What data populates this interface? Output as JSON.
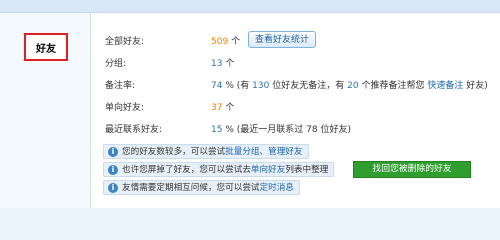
{
  "sidebar": {
    "friend_label": "好友"
  },
  "stats": {
    "all_friends_label": "全部好友:",
    "all_friends_count": "509",
    "all_friends_unit": "个",
    "view_stats_button": "查看好友统计",
    "groups_label": "分组:",
    "groups_count": "13",
    "groups_unit": "个",
    "remark_label": "备注率:",
    "remark_rate": "74",
    "remark_pct": "%",
    "remark_text1": "(有",
    "remark_no_remark_count": "130",
    "remark_text2": "位好友无备注，有",
    "remark_recommend_count": "20",
    "remark_text3": "个推荐备注帮您",
    "quick_remark_link": "快速备注",
    "remark_text4": "好友)",
    "oneway_label": "单向好友:",
    "oneway_count": "37",
    "oneway_unit": "个",
    "recent_label": "最近联系好友:",
    "recent_rate": "15",
    "recent_pct": "%",
    "recent_text1": "(最近一月联系过",
    "recent_count": "78",
    "recent_text2": "位好友)"
  },
  "tips": {
    "tip1_text": "您的好友数较多，可以尝试",
    "tip1_link": "批量分组、管理好友",
    "tip2_text1": "也许您屏掉了好友，您可以尝试去",
    "tip2_link": "单向好友",
    "tip2_text2": "列表中整理",
    "tip3_text": "友情需要定期相互问候，您可以尝试",
    "tip3_link": "定时消息"
  },
  "action": {
    "find_friends_button": "找回您被删除的好友"
  }
}
